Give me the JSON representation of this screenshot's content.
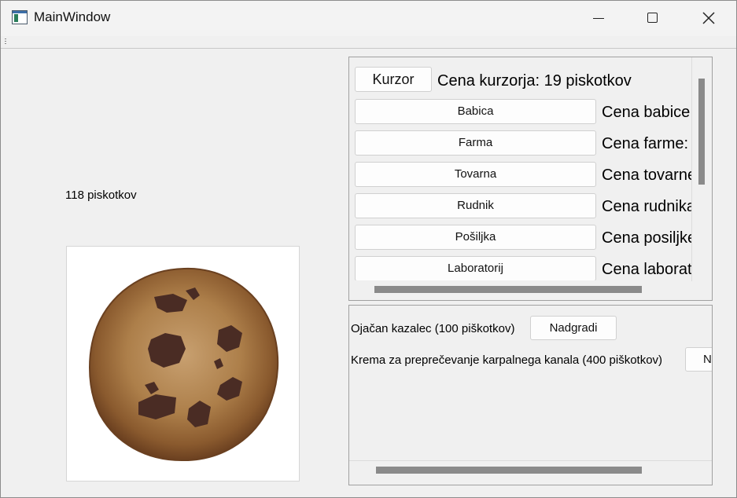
{
  "window": {
    "title": "MainWindow"
  },
  "counter": {
    "text": "118 piskotkov"
  },
  "cookie": {
    "icon": "cookie-image"
  },
  "shop": {
    "cursor": {
      "button": "Kurzor",
      "price": "Cena kurzorja: 19 piskotkov"
    },
    "items": [
      {
        "button": "Babica",
        "price": "Cena babice:"
      },
      {
        "button": "Farma",
        "price": "Cena farme:"
      },
      {
        "button": "Tovarna",
        "price": "Cena tovarne"
      },
      {
        "button": "Rudnik",
        "price": "Cena rudnika"
      },
      {
        "button": "Pošiljka",
        "price": "Cena posiljke"
      },
      {
        "button": "Laboratorij",
        "price": "Cena laborat"
      }
    ]
  },
  "upgrades": [
    {
      "label": "Ojačan kazalec (100 piškotkov)",
      "button": "Nadgradi"
    },
    {
      "label": "Krema za preprečevanje karpalnega kanala (400 piškotkov)",
      "button": "N"
    }
  ],
  "colors": {
    "background": "#f0f0f0",
    "scrollbar": "#8a8a8a",
    "cookie": "#a0713a",
    "chip": "#4a2c24"
  }
}
